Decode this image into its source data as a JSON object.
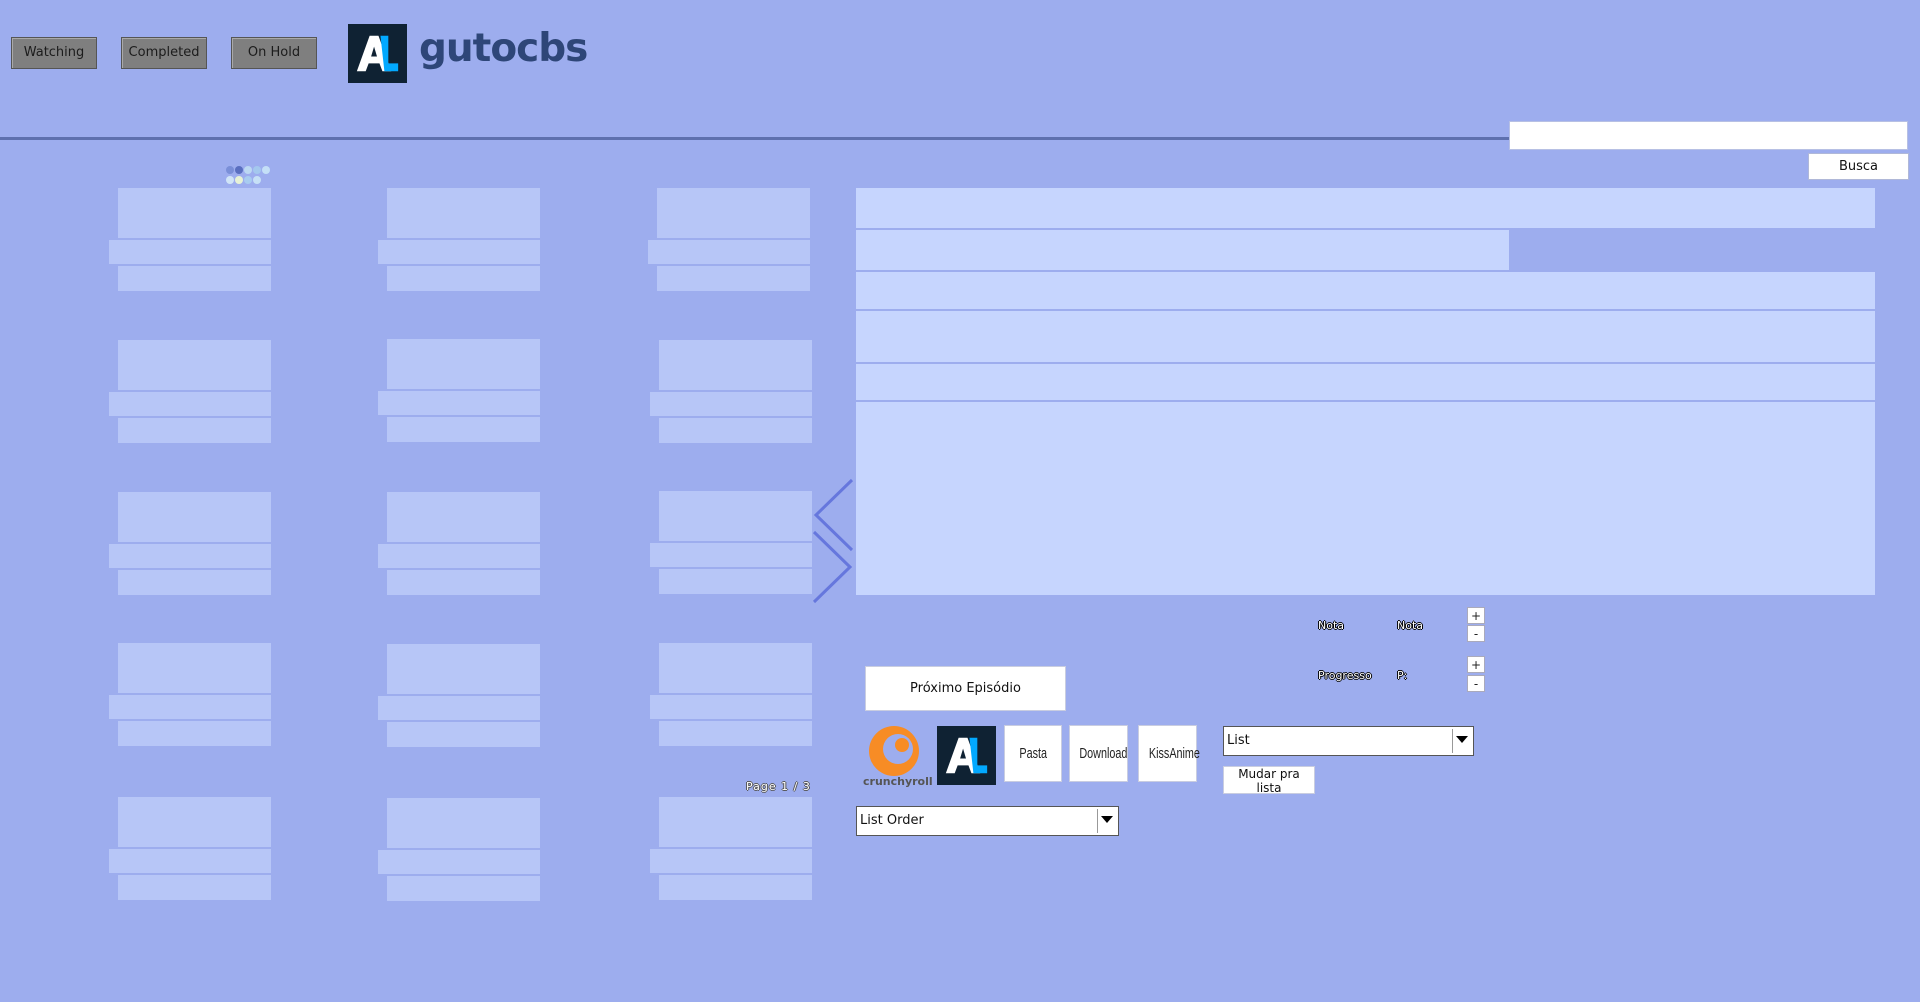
{
  "tabs": [
    {
      "label": "Watching"
    },
    {
      "label": "Completed"
    },
    {
      "label": "On Hold"
    }
  ],
  "header": {
    "username": "gutocbs",
    "logo_letters": "AL"
  },
  "search": {
    "value": "",
    "button_label": "Busca"
  },
  "pagination": {
    "label": "Page 1 / 3"
  },
  "detail": {
    "nota_label": "Nota",
    "nota_value": "Nota",
    "progresso_label": "Progresso",
    "progresso_value": "P:",
    "plus": "+",
    "minus": "-",
    "next_episode_label": "Próximo Episódio"
  },
  "external_links": {
    "crunchyroll": "crunchyroll",
    "pasta": "Pasta",
    "download": "Download",
    "kissanime": "KissAnime"
  },
  "list_select": {
    "value": "List",
    "button_label": "Mudar pra lista"
  },
  "order_select": {
    "value": "List Order"
  },
  "colors": {
    "background": "#9dadee",
    "card": "#b7c6f7",
    "detail": "#c6d5fe",
    "anilist_dark": "#0f2233",
    "anilist_blue": "#02a9ff",
    "crunchyroll_orange": "#f78c25"
  }
}
